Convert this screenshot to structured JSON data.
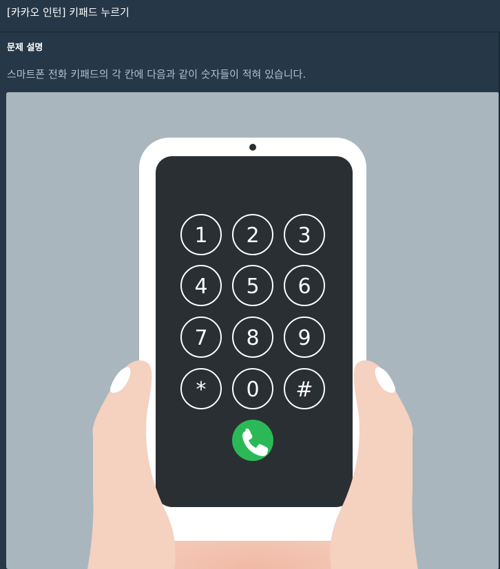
{
  "header": {
    "title": "[카카오 인턴] 키패드 누르기"
  },
  "problem": {
    "section_title": "문제 설명",
    "description": "스마트폰 전화 키패드의 각 칸에 다음과 같이 숫자들이 적혀 있습니다."
  },
  "keypad": {
    "keys": [
      "1",
      "2",
      "3",
      "4",
      "5",
      "6",
      "7",
      "8",
      "9",
      "*",
      "0",
      "#"
    ],
    "call_icon": "phone-icon"
  },
  "colors": {
    "background": "#263747",
    "figure_bg": "#a9b6be",
    "phone_body": "#ffffff",
    "screen": "#2a2f33",
    "call_button": "#2bb957",
    "skin": "#f2cdbb"
  }
}
